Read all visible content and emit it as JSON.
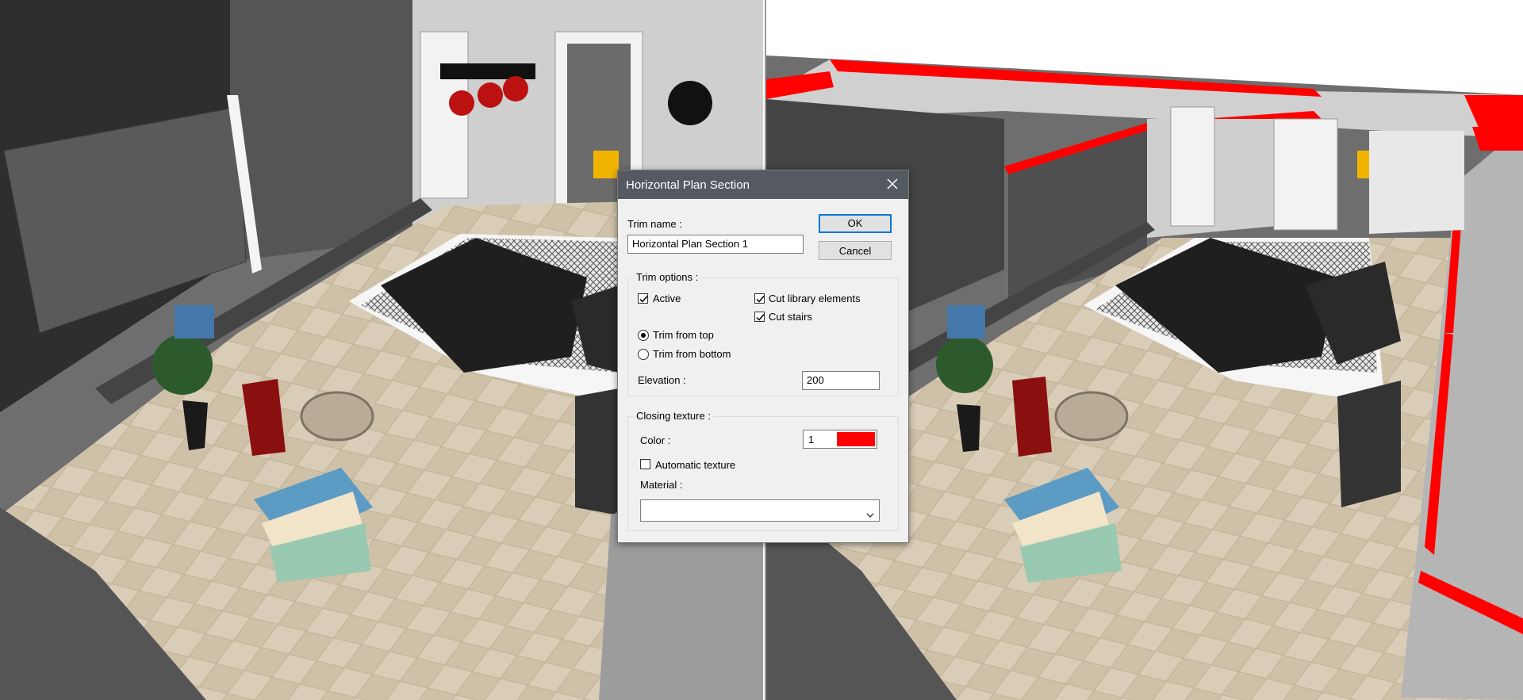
{
  "dialog": {
    "title": "Horizontal Plan Section",
    "trim_name_label": "Trim name :",
    "trim_name_value": "Horizontal Plan Section 1",
    "ok_label": "OK",
    "cancel_label": "Cancel",
    "trim_options": {
      "group_label": "Trim options :",
      "active_label": "Active",
      "active_checked": true,
      "cut_library_label": "Cut library elements",
      "cut_library_checked": true,
      "cut_stairs_label": "Cut stairs",
      "cut_stairs_checked": true,
      "trim_top_label": "Trim from top",
      "trim_top_selected": true,
      "trim_bottom_label": "Trim from bottom",
      "trim_bottom_selected": false,
      "elevation_label": "Elevation :",
      "elevation_value": "200"
    },
    "closing_texture": {
      "group_label": "Closing texture :",
      "color_label": "Color :",
      "color_index": "1",
      "color_swatch": "#ff0000",
      "automatic_texture_label": "Automatic texture",
      "automatic_texture_checked": false,
      "material_label": "Material :",
      "material_value": ""
    }
  },
  "colors": {
    "accent": "#0078d7",
    "section_cut": "#ff0000",
    "titlebar": "#555a60"
  }
}
